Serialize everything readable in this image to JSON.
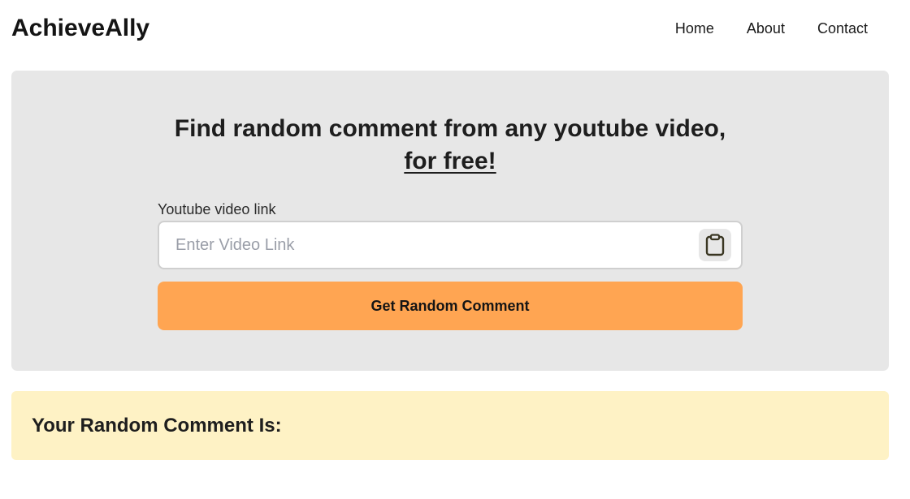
{
  "header": {
    "logo": "AchieveAlly",
    "nav": [
      {
        "label": "Home"
      },
      {
        "label": "About"
      },
      {
        "label": "Contact"
      }
    ]
  },
  "hero": {
    "title_line1": "Find random comment from any youtube video,",
    "title_line2": "for free!",
    "field_label": "Youtube video link",
    "input_placeholder": "Enter Video Link",
    "input_value": "",
    "paste_icon": "clipboard-icon",
    "submit_label": "Get Random Comment"
  },
  "result": {
    "heading": "Your Random Comment Is:"
  },
  "colors": {
    "hero_bg": "#e7e7e7",
    "submit_bg": "#ffa552",
    "result_bg": "#fef2c5"
  }
}
